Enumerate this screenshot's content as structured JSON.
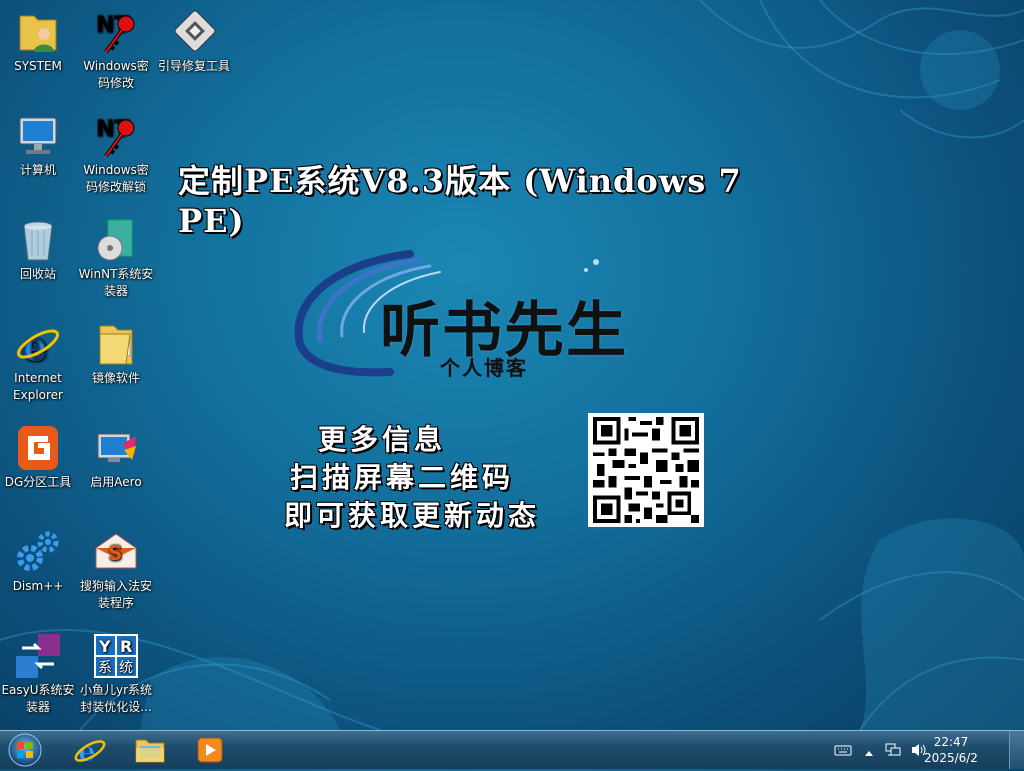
{
  "desktop": {
    "icons": [
      {
        "label": "SYSTEM",
        "icon": "user-folder-icon"
      },
      {
        "label": "Windows密码修改",
        "icon": "nt-key-icon"
      },
      {
        "label": "引导修复工具",
        "icon": "tools-icon"
      },
      {
        "label": "计算机",
        "icon": "computer-icon"
      },
      {
        "label": "Windows密码修改解锁",
        "icon": "nt-key-icon"
      },
      {
        "label": "回收站",
        "icon": "recycle-bin-icon"
      },
      {
        "label": "WinNT系统安装器",
        "icon": "disc-installer-icon"
      },
      {
        "label": "Internet Explorer",
        "icon": "internet-explorer-icon"
      },
      {
        "label": "镜像软件",
        "icon": "folder-icon"
      },
      {
        "label": "DG分区工具",
        "icon": "diskgenius-icon"
      },
      {
        "label": "启用Aero",
        "icon": "aero-icon"
      },
      {
        "label": "Dism++",
        "icon": "gears-icon"
      },
      {
        "label": "搜狗输入法安装程序",
        "icon": "sogou-icon"
      },
      {
        "label": "EasyU系统安装器",
        "icon": "easyu-icon"
      },
      {
        "label": "小鱼儿yr系统封装优化设...",
        "icon": "yr-icon"
      }
    ]
  },
  "banner": {
    "headline": "定制PE系统V8.3版本 (Windows 7 PE)",
    "brand": "听书先生",
    "brand_sub": "个人博客",
    "promo_lines": [
      "更多信息",
      "扫描屏幕二维码",
      "即可获取更新动态"
    ],
    "yr_letters": [
      "Y",
      "R",
      "系",
      "统"
    ]
  },
  "taskbar": {
    "pinned": [
      "internet-explorer-icon",
      "file-explorer-icon",
      "media-player-icon"
    ],
    "tray": [
      "keyboard-icon",
      "show-hidden-icons-icon",
      "network-icon",
      "volume-icon"
    ],
    "time": "22:47",
    "date": "2025/6/2"
  }
}
